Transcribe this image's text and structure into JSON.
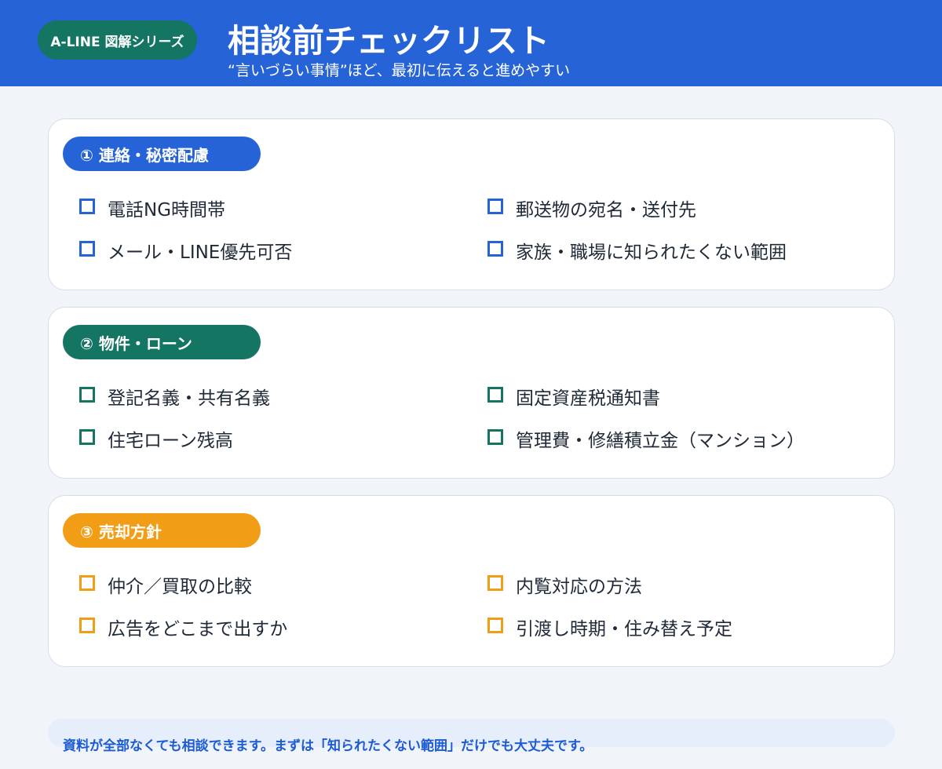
{
  "header": {
    "series_badge": "A-LINE 図解シリーズ",
    "title": "相談前チェックリスト",
    "subtitle": "“言いづらい事情”ほど、最初に伝えると進めやすい",
    "background_color": "#2563d7",
    "badge_color": "#137562"
  },
  "sections": [
    {
      "title": "① 連絡・秘密配慮",
      "color": "#2563d7",
      "items": [
        "電話NG時間帯",
        "郵送物の宛名・送付先",
        "メール・LINE優先可否",
        "家族・職場に知られたくない範囲"
      ]
    },
    {
      "title": "② 物件・ローン",
      "color": "#137562",
      "items": [
        "登記名義・共有名義",
        "固定資産税通知書",
        "住宅ローン残高",
        "管理費・修繕積立金（マンション）"
      ]
    },
    {
      "title": "③ 売却方針",
      "color": "#f29d16",
      "items": [
        "仲介／買取の比較",
        "内覧対応の方法",
        "広告をどこまで出すか",
        "引渡し時期・住み替え予定"
      ]
    }
  ],
  "footer": {
    "note": "資料が全部なくても相談できます。まずは「知られたくない範囲」だけでも大丈夫です。",
    "text_color": "#1d5bd3"
  }
}
